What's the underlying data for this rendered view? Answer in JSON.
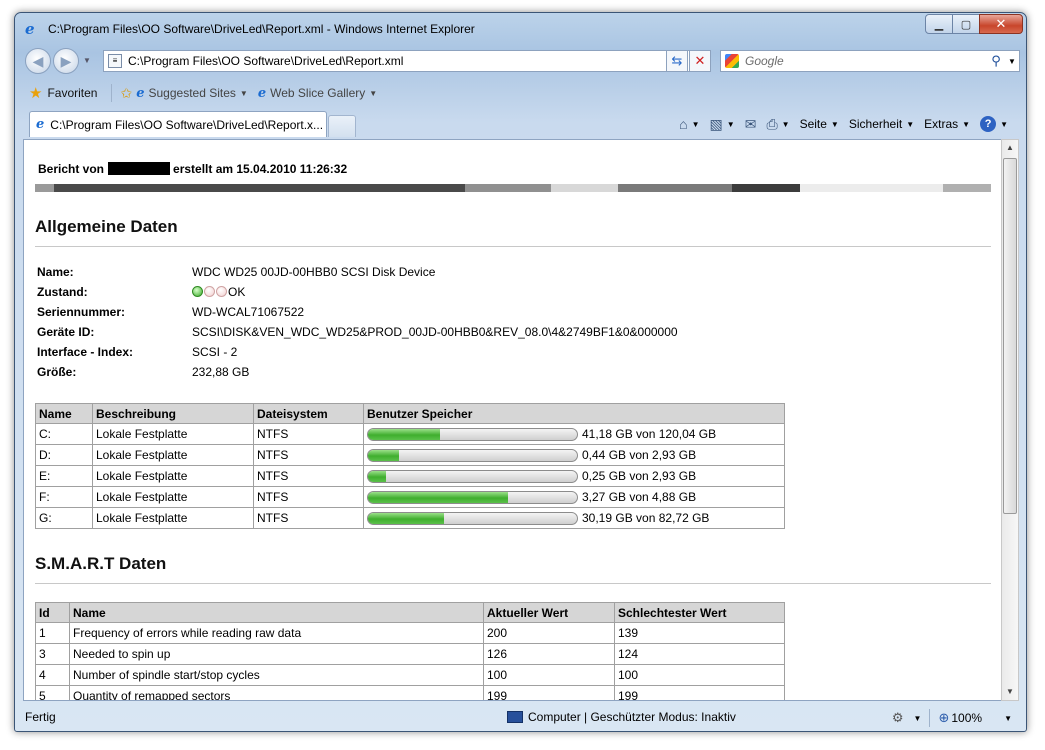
{
  "window": {
    "title": "C:\\Program Files\\OO Software\\DriveLed\\Report.xml - Windows Internet Explorer",
    "buttons": {
      "minimize": "▁",
      "maximize": "▢",
      "close": "✕"
    }
  },
  "address": {
    "url": "C:\\Program Files\\OO Software\\DriveLed\\Report.xml",
    "search_placeholder": "Google"
  },
  "favorites": {
    "favorites_label": "Favoriten",
    "suggested_label": "Suggested Sites",
    "gallery_label": "Web Slice Gallery"
  },
  "tab": {
    "label": "C:\\Program Files\\OO Software\\DriveLed\\Report.x..."
  },
  "commands": {
    "page": "Seite",
    "security": "Sicherheit",
    "tools": "Extras"
  },
  "report": {
    "header_prefix": "Bericht von",
    "header_suffix": "erstellt am 15.04.2010 11:26:32",
    "colorbar": [
      {
        "color": "#9a9a9a",
        "flex": 19
      },
      {
        "color": "#4a4a4a",
        "flex": 411
      },
      {
        "color": "#909090",
        "flex": 86
      },
      {
        "color": "#d8d8d8",
        "flex": 67
      },
      {
        "color": "#7a7a7a",
        "flex": 114
      },
      {
        "color": "#3c3c3c",
        "flex": 68
      },
      {
        "color": "#ececec",
        "flex": 143
      },
      {
        "color": "#b0b0b0",
        "flex": 48
      }
    ]
  },
  "general": {
    "title": "Allgemeine Daten",
    "name_label": "Name:",
    "name_value": "WDC WD25 00JD-00HBB0 SCSI Disk Device",
    "state_label": "Zustand:",
    "state_value": "OK",
    "serial_label": "Seriennummer:",
    "serial_value": "WD-WCAL71067522",
    "device_label": "Geräte ID:",
    "device_value": "SCSI\\DISK&VEN_WDC_WD25&PROD_00JD-00HBB0&REV_08.0\\4&2749BF1&0&000000",
    "interface_label": "Interface - Index:",
    "interface_value": "SCSI - 2",
    "size_label": "Größe:",
    "size_value": "232,88 GB"
  },
  "drives": {
    "headers": [
      "Name",
      "Beschreibung",
      "Dateisystem",
      "Benutzer Speicher"
    ],
    "rows": [
      {
        "name": "C:",
        "desc": "Lokale Festplatte",
        "fs": "NTFS",
        "used": 0.343,
        "text": "41,18 GB von 120,04 GB"
      },
      {
        "name": "D:",
        "desc": "Lokale Festplatte",
        "fs": "NTFS",
        "used": 0.15,
        "text": "0,44 GB von 2,93 GB"
      },
      {
        "name": "E:",
        "desc": "Lokale Festplatte",
        "fs": "NTFS",
        "used": 0.085,
        "text": "0,25 GB von 2,93 GB"
      },
      {
        "name": "F:",
        "desc": "Lokale Festplatte",
        "fs": "NTFS",
        "used": 0.67,
        "text": "3,27 GB von 4,88 GB"
      },
      {
        "name": "G:",
        "desc": "Lokale Festplatte",
        "fs": "NTFS",
        "used": 0.365,
        "text": "30,19 GB von 82,72 GB"
      }
    ]
  },
  "smart": {
    "title": "S.M.A.R.T Daten",
    "headers": [
      "Id",
      "Name",
      "Aktueller Wert",
      "Schlechtester Wert"
    ],
    "rows": [
      {
        "id": "1",
        "name": "Frequency of errors while reading raw data",
        "current": "200",
        "worst": "139"
      },
      {
        "id": "3",
        "name": "Needed to spin up",
        "current": "126",
        "worst": "124"
      },
      {
        "id": "4",
        "name": "Number of spindle start/stop cycles",
        "current": "100",
        "worst": "100"
      },
      {
        "id": "5",
        "name": "Quantity of remapped sectors",
        "current": "199",
        "worst": "199"
      }
    ]
  },
  "status": {
    "left": "Fertig",
    "zone": "Computer | Geschützter Modus: Inaktiv",
    "zoom": "100%"
  }
}
